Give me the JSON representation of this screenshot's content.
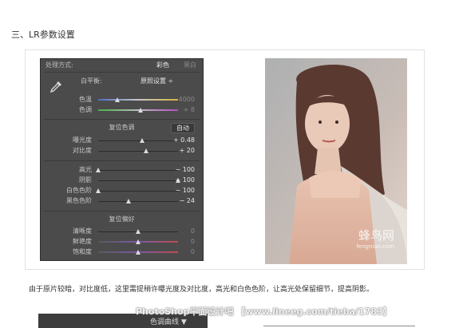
{
  "heading": "三、LR参数设置",
  "panel": {
    "treatment_label": "处理方式:",
    "color_label": "彩色",
    "bw_label": "黑白",
    "wb_label": "白平衡:",
    "wb_value": "原照设置 ÷",
    "temp": {
      "label": "色温",
      "value": "4000",
      "pos": 0.24
    },
    "tint": {
      "label": "色调",
      "value": "+ 8",
      "pos": 0.53
    },
    "tone_title": "复位色调",
    "auto_label": "自动",
    "exposure": {
      "label": "曝光度",
      "value": "+ 0.48",
      "pos": 0.55
    },
    "contrast": {
      "label": "对比度",
      "value": "+ 20",
      "pos": 0.6
    },
    "highlights": {
      "label": "高光",
      "value": "− 100",
      "pos": 0.0
    },
    "shadows": {
      "label": "阴影",
      "value": "+ 100",
      "pos": 1.0
    },
    "whites": {
      "label": "白色色阶",
      "value": "− 100",
      "pos": 0.0
    },
    "blacks": {
      "label": "黑色色阶",
      "value": "− 24",
      "pos": 0.38
    },
    "presence_title": "复位偏好",
    "clarity": {
      "label": "清晰度",
      "value": "0",
      "pos": 0.5
    },
    "vibrance": {
      "label": "鲜艳度",
      "value": "0",
      "pos": 0.5
    },
    "saturation": {
      "label": "饱和度",
      "value": "0",
      "pos": 0.5
    }
  },
  "photo_watermark": {
    "brand": "蜂鸟网",
    "url": "fengniao.com"
  },
  "caption": "由于原片较暗，对比度低，这里需提稍许曝光度及对比度，高光和白色色阶，让高光处保留细节，提高阴影。",
  "bottom_panel_label": "色调曲线 ▼",
  "site_watermark": "PhotoShop平面设计吧 【www.lineeg.com/tieba/1783】"
}
